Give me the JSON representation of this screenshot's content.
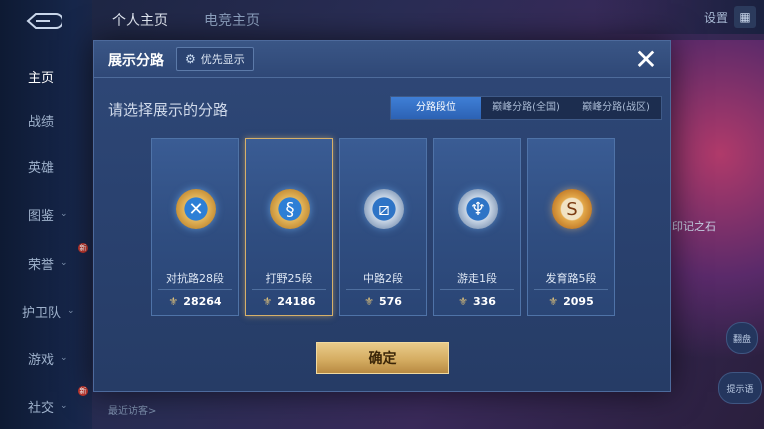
{
  "sidebar": {
    "items": [
      {
        "label": "主页",
        "active": true
      },
      {
        "label": "战绩"
      },
      {
        "label": "英雄"
      },
      {
        "label": "图鉴",
        "has_chevron": true
      },
      {
        "label": "荣誉",
        "has_chevron": true,
        "new_badge": true
      },
      {
        "label": "护卫队",
        "has_chevron": true
      },
      {
        "label": "游戏",
        "has_chevron": true
      },
      {
        "label": "社交",
        "has_chevron": true,
        "new_badge": true
      }
    ],
    "new_badge_text": "新"
  },
  "top_tabs": [
    "个人主页",
    "电竞主页"
  ],
  "top_right": {
    "settings_label": "设置",
    "menu_icon": "grid-icon"
  },
  "background_labels": {
    "right_badge": "印记之石",
    "btn_a": "翻盘",
    "btn_b": "提示语",
    "visitors": "最近访客>"
  },
  "dialog": {
    "title": "展示分路",
    "priority_button": "优先显示",
    "subtitle": "请选择展示的分路",
    "filter_tabs": [
      {
        "label": "分路段位",
        "active": true
      },
      {
        "label": "巅峰分路(全国)",
        "active": false
      },
      {
        "label": "巅峰分路(战区)",
        "active": false
      }
    ],
    "cards": [
      {
        "label": "对抗路28段",
        "score": "28264",
        "emblem": "crossed-swords-icon",
        "style": "gold",
        "selected": false
      },
      {
        "label": "打野25段",
        "score": "24186",
        "emblem": "dragon-icon",
        "style": "gold",
        "selected": true
      },
      {
        "label": "中路2段",
        "score": "576",
        "emblem": "slash-icon",
        "style": "silver",
        "selected": false
      },
      {
        "label": "游走1段",
        "score": "336",
        "emblem": "wings-icon",
        "style": "silver",
        "selected": false
      },
      {
        "label": "发育路5段",
        "score": "2095",
        "emblem": "s-rune-icon",
        "style": "orange",
        "selected": false
      }
    ],
    "confirm_label": "确定"
  },
  "colors": {
    "accent_blue": "#2c62b4",
    "gold": "#d5ad62",
    "panel": "#2a4270"
  }
}
